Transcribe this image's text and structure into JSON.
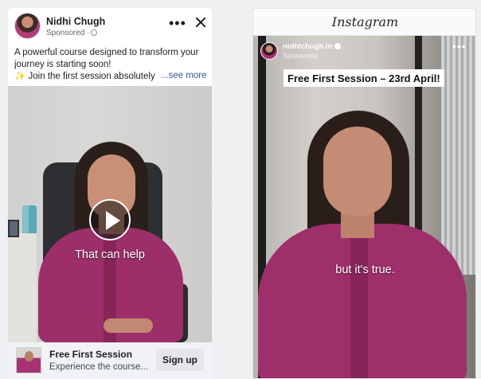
{
  "facebook_ad": {
    "page_name": "Nidhi Chugh",
    "sponsored_label": "Sponsored ·",
    "more_icon": "more-horizontal-icon",
    "close_icon": "close-icon",
    "caption_line1": "A powerful course designed to transform your",
    "caption_line2": "journey is starting soon!",
    "caption_line3_emoji": "✨",
    "caption_line3": "Join the first session absolutely",
    "see_more": "...see more",
    "video": {
      "subtitle": "That can help",
      "play_icon": "play-icon"
    },
    "cta": {
      "title": "Free First Session",
      "description": "Experience the course...",
      "button_label": "Sign up"
    }
  },
  "instagram_ad": {
    "logo_text": "Instagram",
    "handle": "nidhichugh.in",
    "sponsored_label": "Sponsored",
    "more_icon": "more-horizontal-icon",
    "banner_text": "Free First Session – 23rd April!",
    "subtitle": "but it's true."
  },
  "colors": {
    "facebook_link": "#385898",
    "cta_bar_bg": "#f0f2f5",
    "outfit_magenta": "#9c2f69"
  }
}
